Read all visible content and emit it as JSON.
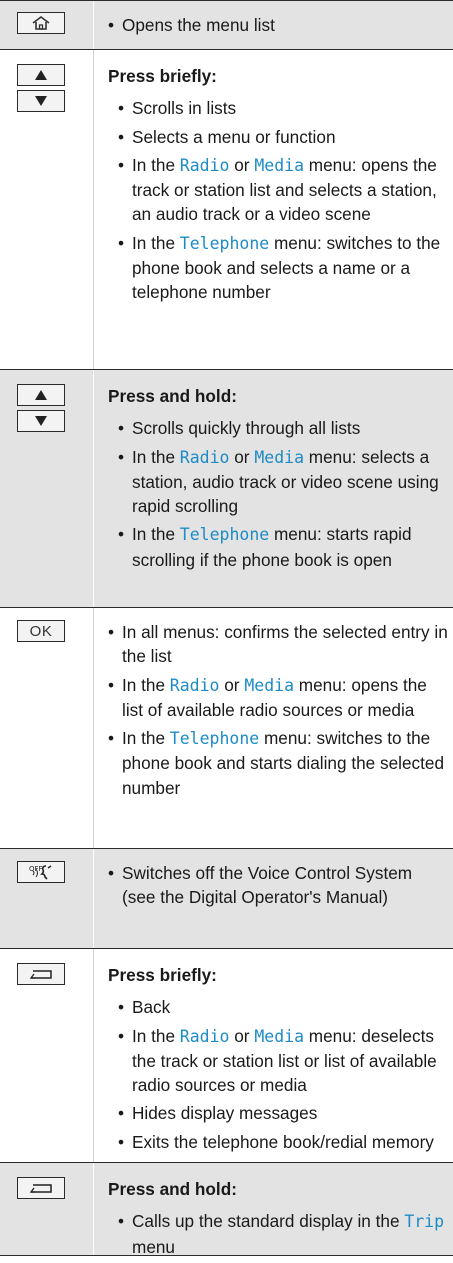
{
  "menu_names": {
    "radio": "Radio",
    "media": "Media",
    "telephone": "Telephone",
    "trip": "Trip"
  },
  "rows": [
    {
      "key": "home",
      "items": [
        "Opens the menu list"
      ]
    },
    {
      "key": "up-down",
      "heading": "Press briefly:",
      "items": [
        "Scrolls in lists",
        "Selects a menu or function",
        "opens the track or station list and selects a station, an audio track or a video scene",
        "switches to the phone book and selects a name or a telephone number"
      ]
    },
    {
      "key": "up-down",
      "heading": "Press and hold:",
      "items": [
        "Scrolls quickly through all lists",
        "selects a station, audio track or video scene using rapid scrolling",
        "starts rapid scrolling if the phone book is open"
      ]
    },
    {
      "key": "ok",
      "key_label": "OK",
      "items": [
        "In all menus: confirms the selected entry in the list",
        "opens the list of available radio sources or media",
        "switches to the phone book and starts dialing the selected number"
      ]
    },
    {
      "key": "voice-off",
      "key_label": "OFF",
      "items": [
        "Switches off the Voice Control System (see the Digital Operator's Manual)"
      ]
    },
    {
      "key": "back",
      "heading": "Press briefly:",
      "items": [
        "Back",
        "deselects the track or station list or list of available radio sources or media",
        "Hides display messages",
        "Exits the telephone book/redial memory"
      ]
    },
    {
      "key": "back",
      "heading": "Press and hold:",
      "items": [
        "Calls up the standard display in the"
      ]
    }
  ],
  "phrases": {
    "in_the": "In the",
    "or": "or",
    "menu_colon": "menu:",
    "menu_colon_dese": "menu: dese-",
    "menu": "menu"
  }
}
